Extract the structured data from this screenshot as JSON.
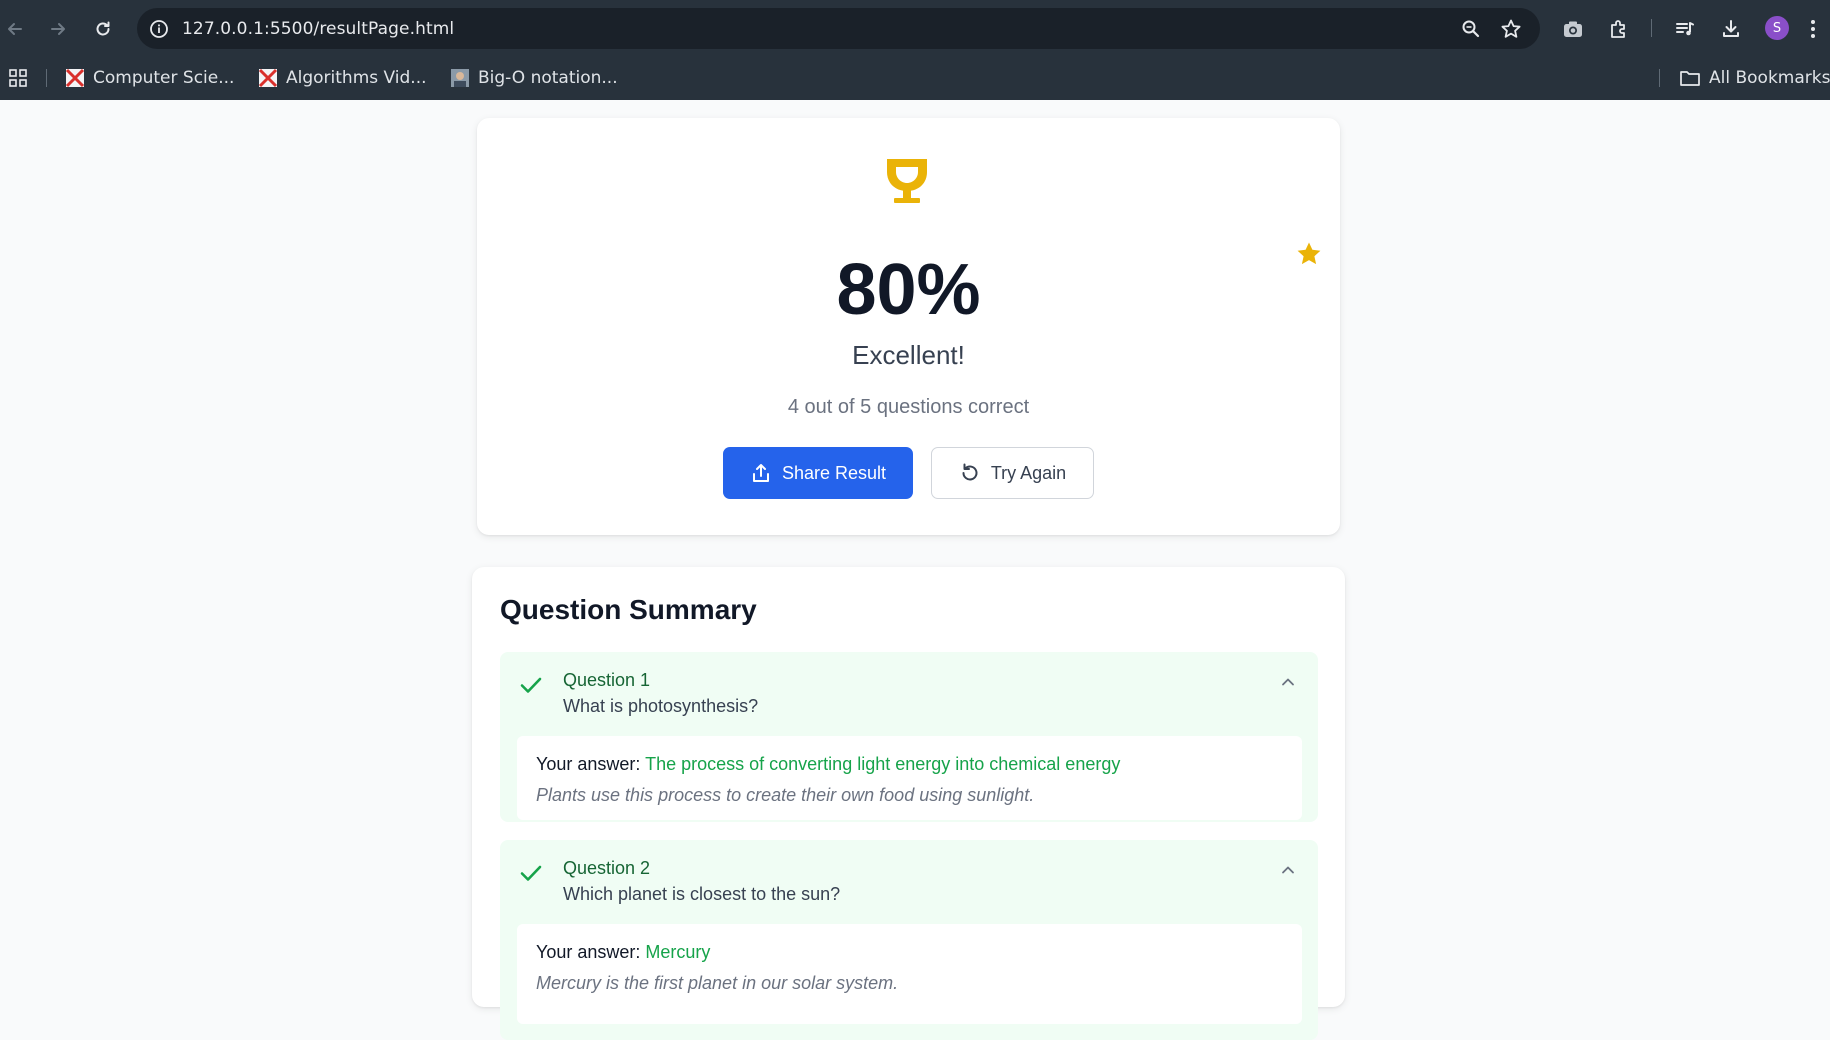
{
  "browser": {
    "url": "127.0.0.1:5500/resultPage.html",
    "avatar_initial": "S",
    "bookmarks": [
      {
        "label": "Computer Scie..."
      },
      {
        "label": "Algorithms Vid..."
      },
      {
        "label": "Big-O notation..."
      }
    ],
    "all_bookmarks_label": "All Bookmarks"
  },
  "result": {
    "score": "80%",
    "grade": "Excellent!",
    "summary": "4 out of 5 questions correct",
    "share_label": "Share Result",
    "retry_label": "Try Again",
    "colors": {
      "trophy": "#eab308",
      "primary": "#2563eb",
      "correct": "#16a34a"
    }
  },
  "question_summary": {
    "title": "Question Summary",
    "answer_prefix": "Your answer:",
    "questions": [
      {
        "number_label": "Question 1",
        "text": "What is photosynthesis?",
        "answer": "The process of converting light energy into chemical energy",
        "explanation": "Plants use this process to create their own food using sunlight.",
        "status": "correct"
      },
      {
        "number_label": "Question 2",
        "text": "Which planet is closest to the sun?",
        "answer": "Mercury",
        "explanation": "Mercury is the first planet in our solar system.",
        "status": "correct"
      }
    ]
  }
}
